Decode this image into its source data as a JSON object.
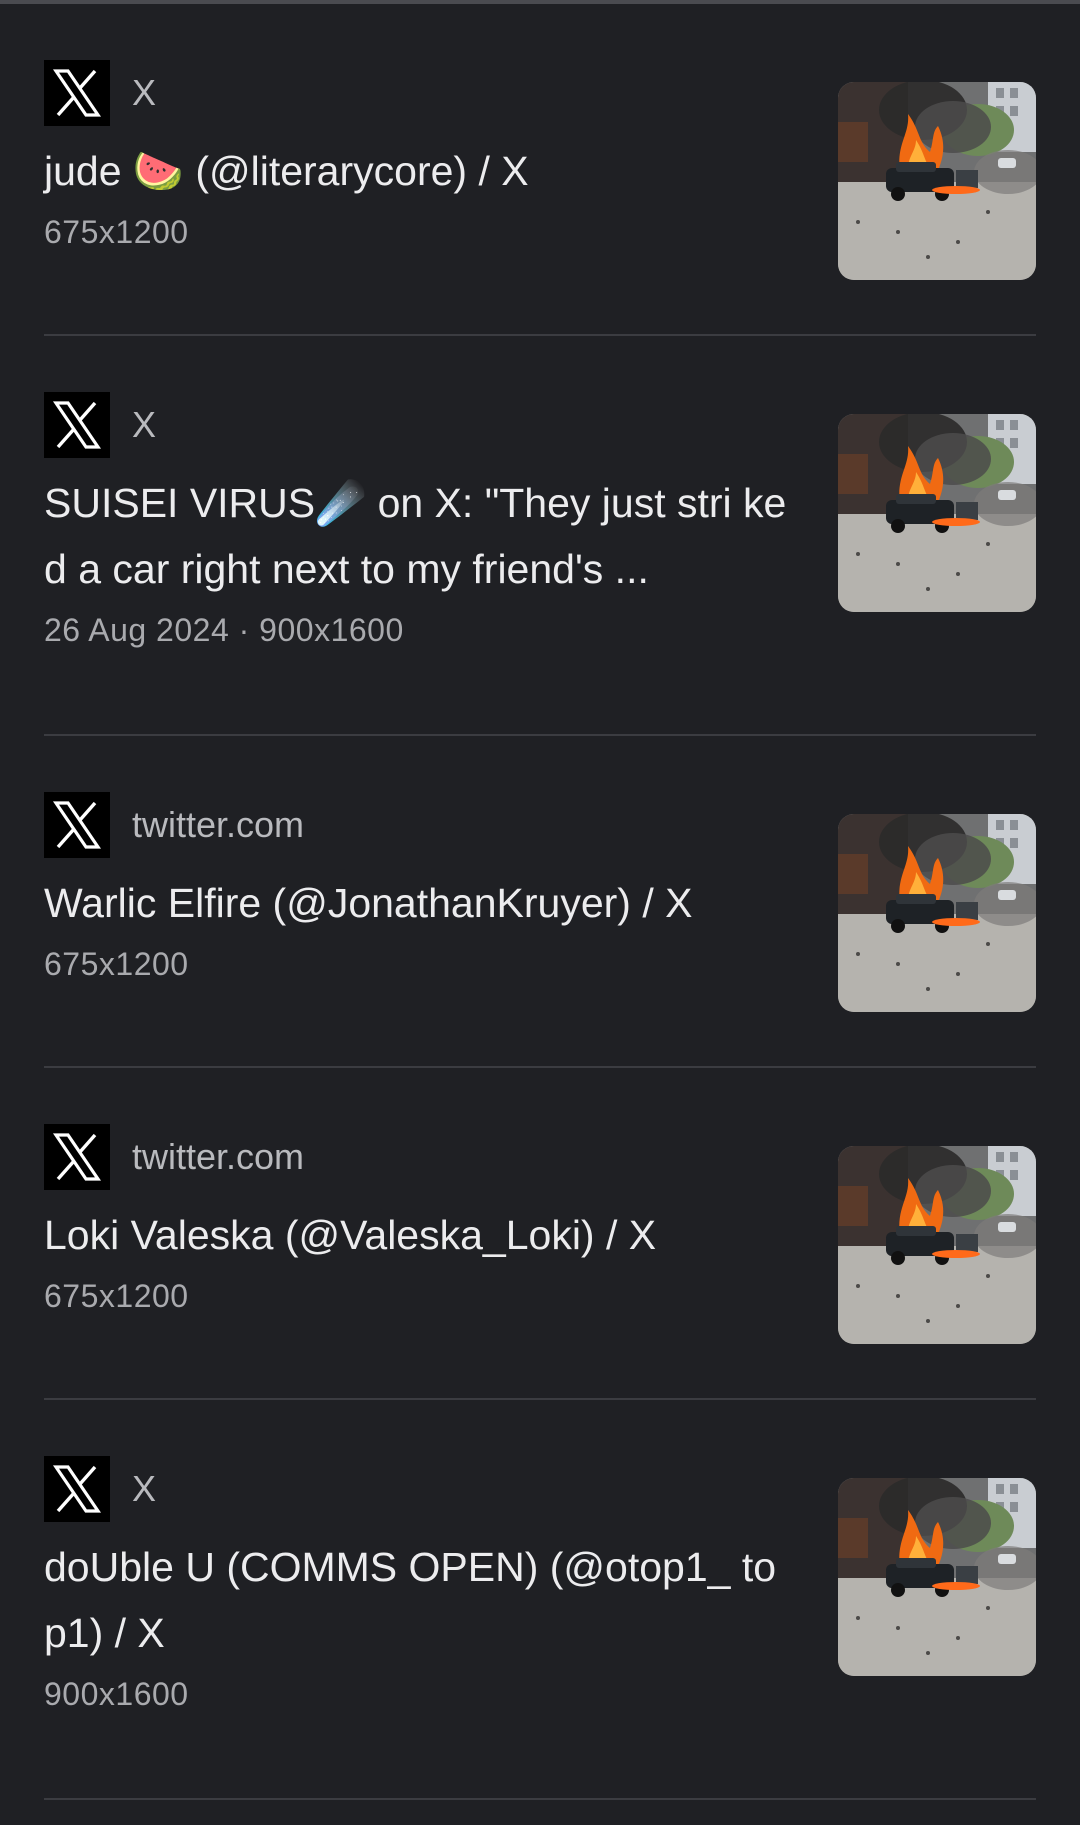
{
  "results": [
    {
      "source_icon": "x-logo-icon",
      "source": "X",
      "title": "jude 🍉 (@literarycore) / X",
      "meta": "675x1200",
      "thumbnail": "burning-car-thumbnail"
    },
    {
      "source_icon": "x-logo-icon",
      "source": "X",
      "title": "SUISEI VIRUS☄️ on X: \"They just stri ked a car right next to my friend's ...",
      "meta": "26 Aug 2024 · 900x1600",
      "thumbnail": "burning-car-thumbnail"
    },
    {
      "source_icon": "x-logo-icon",
      "source": "twitter.com",
      "title": "Warlic Elfire (@JonathanKruyer) / X",
      "meta": "675x1200",
      "thumbnail": "burning-car-thumbnail"
    },
    {
      "source_icon": "x-logo-icon",
      "source": "twitter.com",
      "title": "Loki Valeska (@Valeska_Loki) / X",
      "meta": "675x1200",
      "thumbnail": "burning-car-thumbnail"
    },
    {
      "source_icon": "x-logo-icon",
      "source": "X",
      "title": "doUble U (COMMS OPEN) (@otop1_ top1) / X",
      "meta": "900x1600",
      "thumbnail": "burning-car-thumbnail"
    }
  ],
  "colors": {
    "background": "#1f2024",
    "divider": "#3b3c41",
    "title_text": "#ececee",
    "secondary_text": "#a9aaae"
  }
}
